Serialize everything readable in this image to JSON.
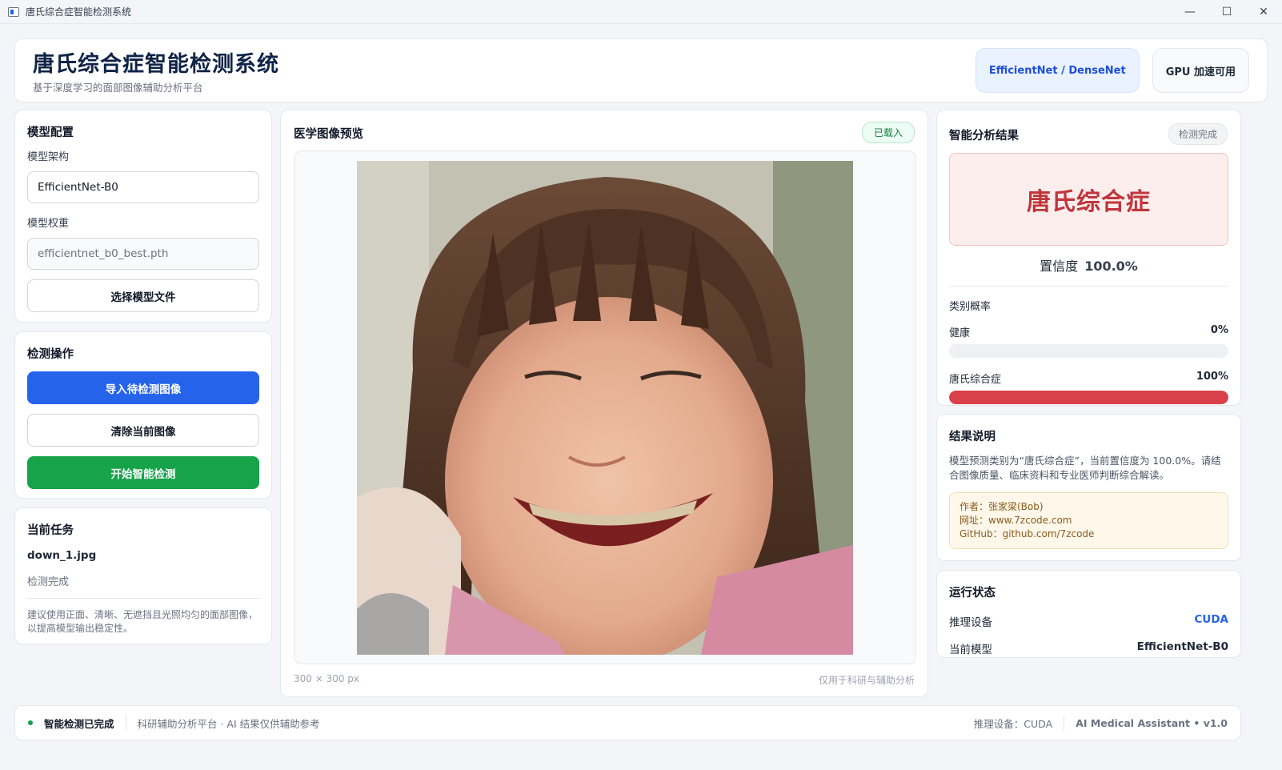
{
  "window": {
    "title": "唐氏综合症智能检测系统",
    "min": "—",
    "max": "☐",
    "close": "✕"
  },
  "header": {
    "title": "唐氏综合症智能检测系统",
    "subtitle": "基于深度学习的面部图像辅助分析平台",
    "model_chip": "EfficientNet / DenseNet",
    "gpu_chip": "GPU 加速可用"
  },
  "model_config": {
    "title": "模型配置",
    "arch_label": "模型架构",
    "arch_value": "EfficientNet-B0",
    "weight_label": "模型权重",
    "weight_value": "efficientnet_b0_best.pth",
    "select_button": "选择模型文件"
  },
  "detect_ops": {
    "title": "检测操作",
    "import_button": "导入待检测图像",
    "clear_button": "清除当前图像",
    "start_button": "开始智能检测"
  },
  "current_task": {
    "title": "当前任务",
    "filename": "down_1.jpg",
    "status": "检测完成",
    "tip": "建议使用正面、清晰、无遮挡且光照均匀的面部图像，以提高模型输出稳定性。"
  },
  "preview": {
    "title": "医学图像预览",
    "badge": "已载入",
    "size_text": "300 × 300 px",
    "disclaimer": "仅用于科研与辅助分析"
  },
  "results": {
    "title": "智能分析结果",
    "status": "检测完成",
    "diagnosis": "唐氏综合症",
    "confidence_label": "置信度",
    "confidence_value": "100.0%",
    "prob_title": "类别概率",
    "classes": [
      {
        "name": "健康",
        "percent_text": "0%",
        "fraction": 0.0
      },
      {
        "name": "唐氏综合症",
        "percent_text": "100%",
        "fraction": 1.0
      }
    ]
  },
  "explanation": {
    "title": "结果说明",
    "text": "模型预测类别为“唐氏综合症”，当前置信度为 100.0%。请结合图像质量、临床资料和专业医师判断综合解读。",
    "author": "作者：张家梁(Bob)",
    "website": "网址：www.7zcode.com",
    "github": "GitHub：github.com/7zcode"
  },
  "runtime": {
    "title": "运行状态",
    "device_label": "推理设备",
    "device_value": "CUDA",
    "model_label": "当前模型",
    "model_value": "EfficientNet-B0"
  },
  "footer": {
    "status": "智能检测已完成",
    "note": "科研辅助分析平台 · AI 结果仅供辅助参考",
    "device": "推理设备：CUDA",
    "version": "AI Medical Assistant  •  v1.0"
  },
  "colors": {
    "primary": "#2563eb",
    "success": "#16a34a",
    "danger": "#d9414a"
  }
}
